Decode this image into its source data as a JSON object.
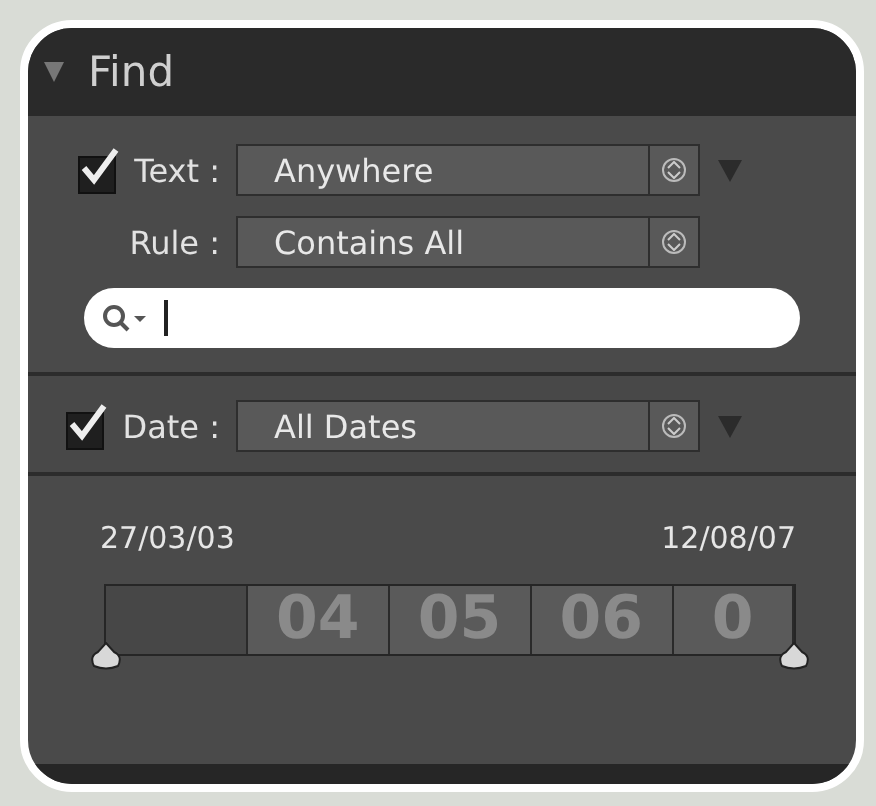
{
  "panel": {
    "title": "Find",
    "expanded": true
  },
  "text_filter": {
    "checked": true,
    "label": "Text :",
    "value": "Anywhere"
  },
  "rule": {
    "label": "Rule :",
    "value": "Contains All"
  },
  "date_filter": {
    "checked": true,
    "label": "Date :",
    "value": "All Dates"
  },
  "date_range": {
    "start": "27/03/03",
    "end": "12/08/07",
    "bins": [
      {
        "kind": "empty"
      },
      {
        "kind": "year",
        "label": "04"
      },
      {
        "kind": "year",
        "label": "05"
      },
      {
        "kind": "year",
        "label": "06"
      },
      {
        "kind": "year",
        "label": "0"
      }
    ],
    "handles": [
      {
        "level": 0
      },
      {
        "level": 1
      }
    ]
  }
}
